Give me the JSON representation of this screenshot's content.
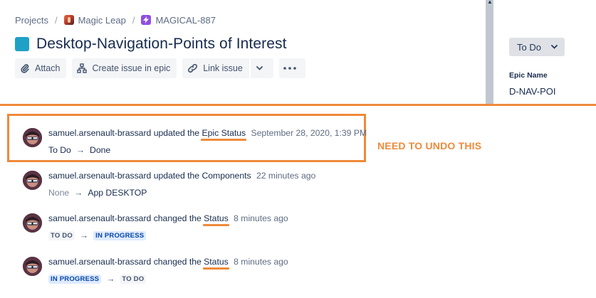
{
  "breadcrumb": {
    "projects": "Projects",
    "project": "Magic Leap",
    "issue_key": "MAGICAL-887"
  },
  "issue": {
    "title": "Desktop-Navigation-Points of Interest",
    "swatch_color": "#1fa1c6"
  },
  "toolbar": {
    "attach": "Attach",
    "create_in_epic": "Create issue in epic",
    "link_issue": "Link issue"
  },
  "side_panel": {
    "status": "To Do",
    "epic_name_label": "Epic Name",
    "epic_name_value": "D-NAV-POI"
  },
  "annotation": {
    "note": "NEED TO UNDO THIS",
    "color": "#ef8a3a"
  },
  "history": [
    {
      "user": "samuel.arsenault-brassard",
      "action": "updated the",
      "field": "Epic Status",
      "time": "September 28, 2020, 1:39 PM",
      "from": "To Do",
      "to": "Done"
    },
    {
      "user": "samuel.arsenault-brassard",
      "action": "updated the",
      "field": "Components",
      "time": "22 minutes ago",
      "from": "None",
      "to": "App DESKTOP"
    },
    {
      "user": "samuel.arsenault-brassard",
      "action": "changed the",
      "field": "Status",
      "time": "8 minutes ago",
      "from": "TO DO",
      "to": "IN PROGRESS"
    },
    {
      "user": "samuel.arsenault-brassard",
      "action": "changed the",
      "field": "Status",
      "time": "8 minutes ago",
      "from": "IN PROGRESS",
      "to": "TO DO"
    }
  ]
}
